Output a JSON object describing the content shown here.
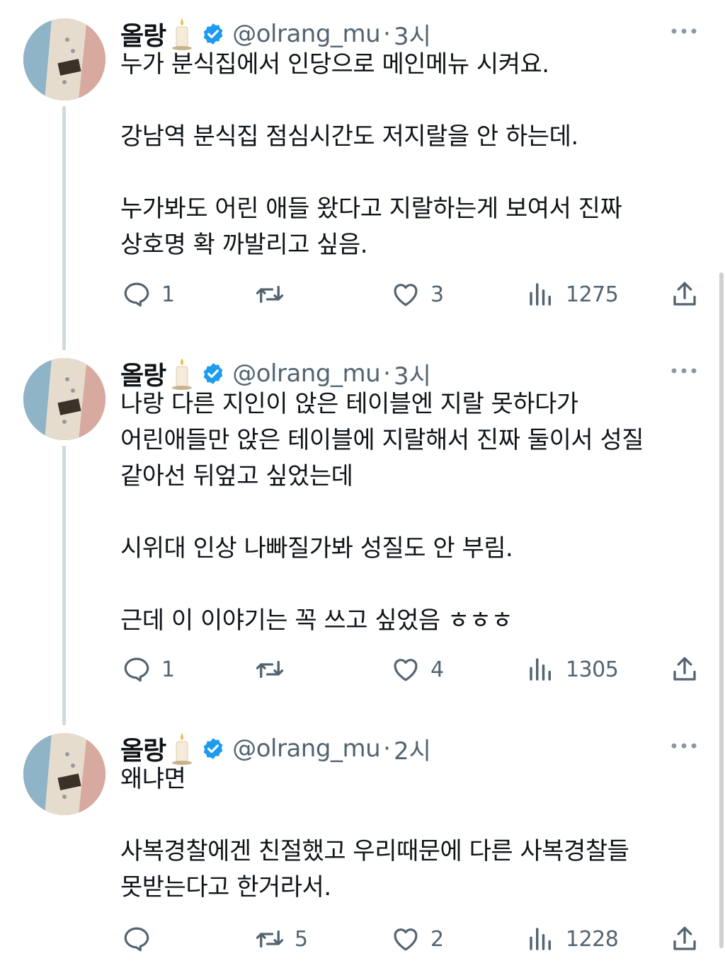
{
  "author": {
    "display_name": "올랑",
    "handle": "@olrang_mu",
    "avatar_icon": "guitar-closeup-avatar",
    "name_emoji_icon": "candle-icon",
    "verified_icon": "verified-badge-icon"
  },
  "tweets": [
    {
      "time": "3시",
      "separator": "·",
      "paragraphs": [
        [
          "누가 분식집에서 인당으로 메인메뉴 시켜요."
        ],
        [
          "강남역 분식집 점심시간도 저지랄을 안 하는데."
        ],
        [
          "누가봐도 어린 애들 왔다고 지랄하는게 보여서 진짜",
          "상호명 확 까발리고 싶음."
        ]
      ],
      "replies": "1",
      "retweets": "",
      "likes": "3",
      "views": "1275"
    },
    {
      "time": "3시",
      "separator": "·",
      "paragraphs": [
        [
          "나랑 다른 지인이 앉은 테이블엔 지랄 못하다가",
          "어린애들만 앉은 테이블에 지랄해서 진짜 둘이서 성질",
          "같아선 뒤엎고 싶었는데"
        ],
        [
          "시위대 인상 나빠질가봐 성질도 안 부림."
        ],
        [
          "근데 이 이야기는 꼭 쓰고 싶었음 ㅎㅎㅎ"
        ]
      ],
      "replies": "1",
      "retweets": "",
      "likes": "4",
      "views": "1305"
    },
    {
      "time": "2시",
      "separator": "·",
      "paragraphs": [
        [
          "왜냐면"
        ],
        [
          "사복경찰에겐 친절했고 우리때문에 다른 사복경찰들",
          "못받는다고 한거라서."
        ]
      ],
      "replies": "",
      "retweets": "5",
      "likes": "2",
      "views": "1228"
    }
  ],
  "colors": {
    "text": "#0f1419",
    "secondary": "#536471",
    "verified": "#1d9bf0",
    "thread_line": "#cfd9de"
  }
}
